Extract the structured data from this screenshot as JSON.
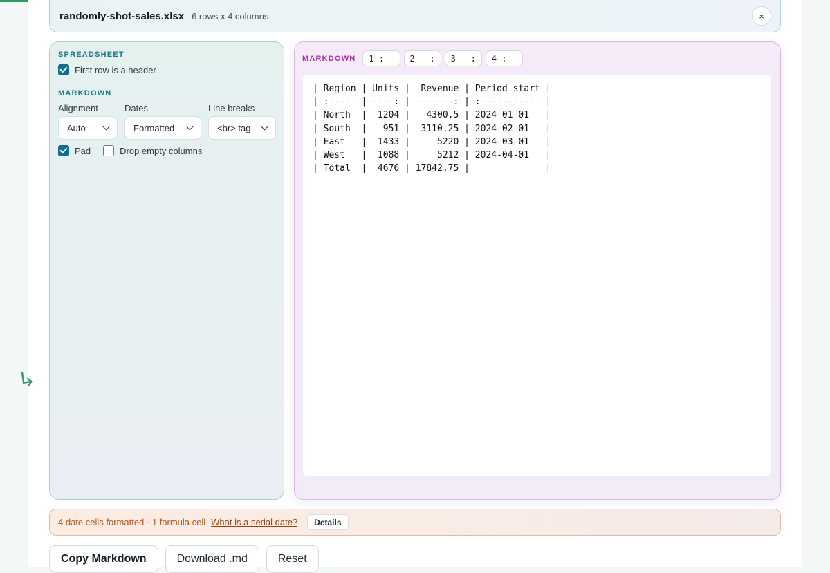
{
  "file": {
    "name": "randomly-shot-sales.xlsx",
    "meta": "6 rows x 4 columns",
    "close_glyph": "×"
  },
  "settings": {
    "spreadsheet_heading": "SPREADSHEET",
    "header_row": {
      "label": "First row is a header",
      "checked": true
    },
    "markdown_heading": "MARKDOWN",
    "alignment": {
      "label": "Alignment",
      "value": "Auto"
    },
    "dates": {
      "label": "Dates",
      "value": "Formatted"
    },
    "line_breaks": {
      "label": "Line breaks",
      "value": "<br> tag"
    },
    "pad": {
      "label": "Pad",
      "checked": true
    },
    "drop_empty": {
      "label": "Drop empty columns",
      "checked": false
    }
  },
  "markdown": {
    "heading": "MARKDOWN",
    "column_chips": [
      "1 :--",
      "2 --:",
      "3 --:",
      "4 :--"
    ],
    "output": "| Region | Units |  Revenue | Period start |\n| :----- | ----: | -------: | :----------- |\n| North  |  1204 |   4300.5 | 2024-01-01   |\n| South  |   951 |  3110.25 | 2024-02-01   |\n| East   |  1433 |     5220 | 2024-03-01   |\n| West   |  1088 |     5212 | 2024-04-01   |\n| Total  |  4676 | 17842.75 |              |"
  },
  "info": {
    "text": "4 date cells formatted · 1 formula cell",
    "link": "What is a serial date?",
    "details": "Details"
  },
  "actions": {
    "copy": "Copy Markdown",
    "download": "Download .md",
    "reset": "Reset"
  },
  "colors": {
    "accent": "#106f8d",
    "markdown_accent": "#b02fae",
    "warning": "#b8551c",
    "success": "#2e9a5e"
  }
}
